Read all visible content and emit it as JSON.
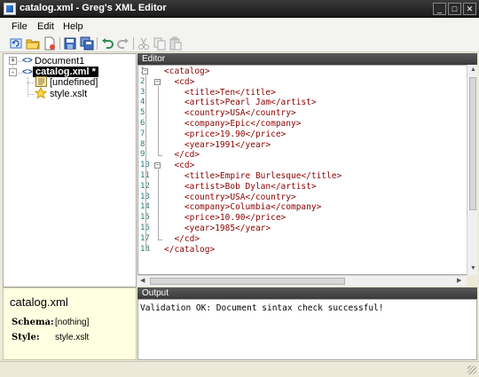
{
  "window": {
    "title": "catalog.xml - Greg's XML Editor"
  },
  "menu": {
    "file": "File",
    "edit": "Edit",
    "help": "Help"
  },
  "toolbar": {
    "icons": [
      "refresh-icon",
      "open-folder-icon",
      "new-document-icon",
      "save-icon",
      "save-all-icon",
      "undo-icon",
      "redo-icon",
      "cut-icon",
      "copy-icon",
      "paste-icon"
    ]
  },
  "tree": {
    "items": [
      {
        "label": "Document1",
        "expander": "+"
      },
      {
        "label": "catalog.xml *",
        "expander": "-"
      },
      {
        "label": "[undefined]"
      },
      {
        "label": "style.xslt"
      }
    ],
    "tag_glyph": "<>"
  },
  "info": {
    "title": "catalog.xml",
    "schema_label": "Schema:",
    "schema_value": "[nothing]",
    "style_label": "Style:",
    "style_value": "style.xslt"
  },
  "editor": {
    "header": "Editor",
    "lines": [
      {
        "n": "1",
        "text": "<catalog>"
      },
      {
        "n": "2",
        "text": "  <cd>"
      },
      {
        "n": "3",
        "text": "    <title>Ten</title>"
      },
      {
        "n": "4",
        "text": "    <artist>Pearl Jam</artist>"
      },
      {
        "n": "5",
        "text": "    <country>USA</country>"
      },
      {
        "n": "6",
        "text": "    <company>Epic</company>"
      },
      {
        "n": "7",
        "text": "    <price>19.90</price>"
      },
      {
        "n": "8",
        "text": "    <year>1991</year>"
      },
      {
        "n": "9",
        "text": "  </cd>"
      },
      {
        "n": "10",
        "text": "  <cd>"
      },
      {
        "n": "11",
        "text": "    <title>Empire Burlesque</title>"
      },
      {
        "n": "12",
        "text": "    <artist>Bob Dylan</artist>"
      },
      {
        "n": "13",
        "text": "    <country>USA</country>"
      },
      {
        "n": "14",
        "text": "    <company>Columbia</company>"
      },
      {
        "n": "15",
        "text": "    <price>10.90</price>"
      },
      {
        "n": "16",
        "text": "    <year>1985</year>"
      },
      {
        "n": "17",
        "text": "  </cd>"
      },
      {
        "n": "18",
        "text": "</catalog>"
      }
    ]
  },
  "output": {
    "header": "Output",
    "text": "Validation OK: Document sintax check successful!"
  },
  "colors": {
    "tag": "#8b0000",
    "line_number": "#2b7a78",
    "info_bg": "#ffffe1",
    "selection": "#000000"
  }
}
